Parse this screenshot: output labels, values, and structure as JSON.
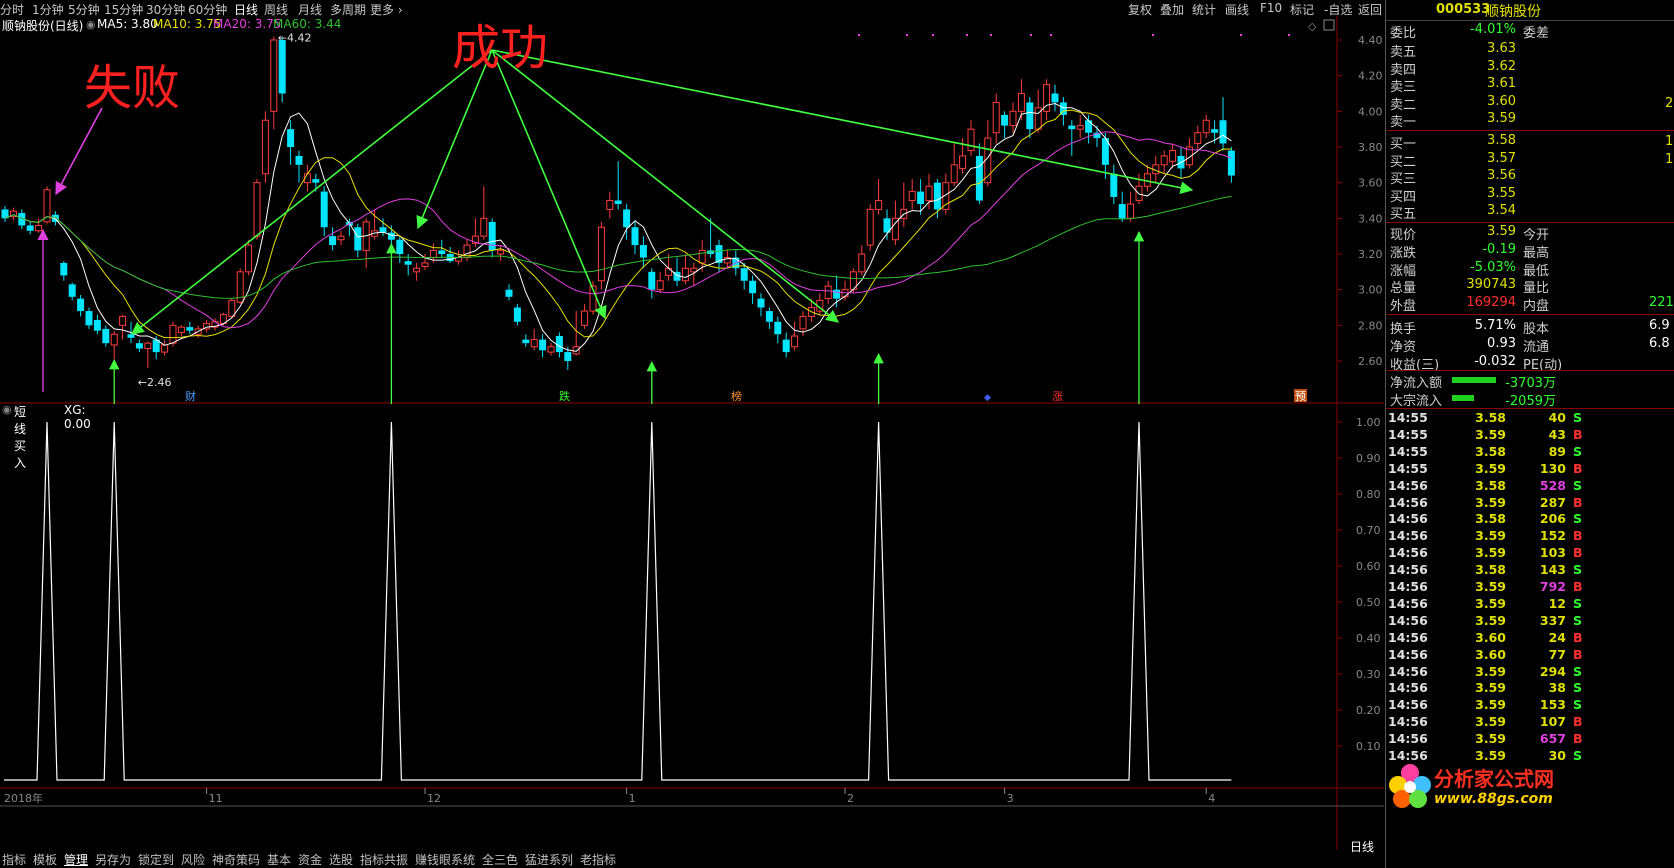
{
  "toolbar": {
    "periods": [
      "分时",
      "1分钟",
      "5分钟",
      "15分钟",
      "30分钟",
      "60分钟",
      "日线",
      "周线",
      "月线",
      "多周期",
      "更多 ›"
    ],
    "active_period": "日线",
    "right_items": [
      "复权",
      "叠加",
      "统计",
      "画线",
      "F10",
      "标记",
      "-自选",
      "返回"
    ]
  },
  "main_info": {
    "name": "顺钠股份(日线)",
    "ma5": "MA5: 3.80",
    "ma10": "MA10: 3.75",
    "ma20": "MA20: 3.75",
    "ma60": "MA60: 3.44"
  },
  "colors": {
    "up": "#ff3c3c",
    "down": "#00e5ff",
    "ma5": "#ffffff",
    "ma10": "#e8e000",
    "ma20": "#e040e0",
    "ma60": "#30c030",
    "annot_green": "#40ff40",
    "annot_red": "#ff2020",
    "annot_magenta": "#e040e0"
  },
  "annotations": {
    "fail": "失败",
    "success": "成功",
    "high_label": "4.42",
    "low_label": "2.46"
  },
  "event_tags": [
    {
      "text": "财",
      "color": "#4aa0ff"
    },
    {
      "text": "跌",
      "color": "#30ff30"
    },
    {
      "text": "榜",
      "color": "#ff9030"
    },
    {
      "text": "涨",
      "color": "#ff3030"
    },
    {
      "text": "预",
      "color": "#ffffff",
      "bg": "#c05010"
    }
  ],
  "indicator_info": {
    "name": "短线买入",
    "xg": "XG: 0.00"
  },
  "chart_data": [
    {
      "type": "candlestick",
      "title": "顺钠股份(日线)",
      "ylim": [
        2.46,
        4.42
      ],
      "y_ticks": [
        "4.40",
        "4.20",
        "4.00",
        "3.80",
        "3.60",
        "3.40",
        "3.20",
        "3.00",
        "2.80",
        "2.60"
      ],
      "x_labels": [
        "2018年",
        "11",
        "12",
        "1",
        "2",
        "3",
        "4"
      ],
      "candles": [
        [
          3.45,
          3.4,
          3.47,
          3.38
        ],
        [
          3.41,
          3.44,
          3.46,
          3.39
        ],
        [
          3.43,
          3.36,
          3.45,
          3.34
        ],
        [
          3.36,
          3.33,
          3.38,
          3.31
        ],
        [
          3.33,
          3.36,
          3.4,
          3.32
        ],
        [
          3.38,
          3.56,
          3.58,
          3.37
        ],
        [
          3.42,
          3.38,
          3.44,
          3.36
        ],
        [
          3.15,
          3.08,
          3.16,
          3.05
        ],
        [
          3.03,
          2.96,
          3.04,
          2.94
        ],
        [
          2.95,
          2.88,
          2.97,
          2.85
        ],
        [
          2.88,
          2.8,
          2.9,
          2.78
        ],
        [
          2.83,
          2.77,
          2.86,
          2.75
        ],
        [
          2.78,
          2.7,
          2.8,
          2.68
        ],
        [
          2.69,
          2.75,
          2.77,
          2.61
        ],
        [
          2.8,
          2.85,
          2.86,
          2.72
        ],
        [
          2.75,
          2.73,
          2.82,
          2.7
        ],
        [
          2.7,
          2.67,
          2.72,
          2.65
        ],
        [
          2.67,
          2.7,
          2.71,
          2.56
        ],
        [
          2.72,
          2.65,
          2.74,
          2.61
        ],
        [
          2.65,
          2.69,
          2.72,
          2.63
        ],
        [
          2.7,
          2.8,
          2.82,
          2.68
        ],
        [
          2.76,
          2.79,
          2.8,
          2.74
        ],
        [
          2.79,
          2.77,
          2.82,
          2.75
        ],
        [
          2.75,
          2.78,
          2.8,
          2.73
        ],
        [
          2.78,
          2.81,
          2.83,
          2.76
        ],
        [
          2.79,
          2.82,
          2.84,
          2.77
        ],
        [
          2.81,
          2.86,
          2.87,
          2.8
        ],
        [
          2.85,
          2.94,
          2.95,
          2.84
        ],
        [
          2.93,
          3.1,
          3.12,
          2.92
        ],
        [
          3.1,
          3.25,
          3.28,
          3.08
        ],
        [
          3.3,
          3.6,
          3.62,
          3.28
        ],
        [
          3.65,
          3.95,
          4.0,
          3.6
        ],
        [
          4.0,
          4.4,
          4.42,
          3.9
        ],
        [
          4.4,
          4.1,
          4.42,
          4.05
        ],
        [
          3.9,
          3.8,
          3.95,
          3.7
        ],
        [
          3.75,
          3.7,
          3.78,
          3.6
        ],
        [
          3.6,
          3.65,
          3.7,
          3.55
        ],
        [
          3.62,
          3.6,
          3.65,
          3.55
        ],
        [
          3.55,
          3.35,
          3.58,
          3.3
        ],
        [
          3.3,
          3.25,
          3.35,
          3.22
        ],
        [
          3.28,
          3.3,
          3.33,
          3.25
        ],
        [
          3.38,
          3.36,
          3.4,
          3.3
        ],
        [
          3.35,
          3.22,
          3.37,
          3.18
        ],
        [
          3.22,
          3.38,
          3.4,
          3.12
        ],
        [
          3.3,
          3.33,
          3.45,
          3.28
        ],
        [
          3.35,
          3.32,
          3.4,
          3.3
        ],
        [
          3.32,
          3.28,
          3.36,
          3.24
        ],
        [
          3.28,
          3.2,
          3.3,
          3.15
        ],
        [
          3.16,
          3.14,
          3.2,
          3.08
        ],
        [
          3.1,
          3.12,
          3.15,
          3.05
        ],
        [
          3.13,
          3.15,
          3.2,
          3.11
        ],
        [
          3.18,
          3.22,
          3.26,
          3.15
        ],
        [
          3.22,
          3.2,
          3.28,
          3.18
        ],
        [
          3.2,
          3.16,
          3.24,
          3.15
        ],
        [
          3.16,
          3.18,
          3.22,
          3.14
        ],
        [
          3.18,
          3.25,
          3.28,
          3.16
        ],
        [
          3.26,
          3.3,
          3.4,
          3.24
        ],
        [
          3.3,
          3.4,
          3.58,
          3.28
        ],
        [
          3.38,
          3.22,
          3.4,
          3.18
        ],
        [
          3.2,
          3.22,
          3.25,
          3.16
        ],
        [
          3.0,
          2.96,
          3.03,
          2.94
        ],
        [
          2.9,
          2.82,
          2.92,
          2.8
        ],
        [
          2.72,
          2.7,
          2.75,
          2.68
        ],
        [
          2.68,
          2.72,
          2.78,
          2.66
        ],
        [
          2.72,
          2.66,
          2.75,
          2.62
        ],
        [
          2.65,
          2.68,
          2.7,
          2.63
        ],
        [
          2.74,
          2.65,
          2.76,
          2.62
        ],
        [
          2.65,
          2.6,
          2.68,
          2.55
        ],
        [
          2.64,
          2.68,
          2.88,
          2.63
        ],
        [
          2.8,
          2.88,
          2.92,
          2.78
        ],
        [
          2.88,
          3.02,
          3.05,
          2.86
        ],
        [
          3.05,
          3.35,
          3.38,
          3.0
        ],
        [
          3.45,
          3.5,
          3.55,
          3.4
        ],
        [
          3.5,
          3.48,
          3.72,
          3.45
        ],
        [
          3.45,
          3.35,
          3.48,
          3.28
        ],
        [
          3.35,
          3.25,
          3.38,
          3.2
        ],
        [
          3.25,
          3.18,
          3.3,
          3.12
        ],
        [
          3.1,
          3.0,
          3.12,
          2.95
        ],
        [
          3.0,
          3.05,
          3.1,
          2.98
        ],
        [
          3.08,
          3.12,
          3.2,
          3.05
        ],
        [
          3.1,
          3.05,
          3.18,
          3.02
        ],
        [
          3.05,
          3.12,
          3.2,
          3.03
        ],
        [
          3.1,
          3.12,
          3.15,
          3.02
        ],
        [
          3.15,
          3.22,
          3.28,
          3.1
        ],
        [
          3.22,
          3.2,
          3.4,
          3.18
        ],
        [
          3.25,
          3.15,
          3.28,
          3.1
        ],
        [
          3.15,
          3.18,
          3.22,
          3.12
        ],
        [
          3.18,
          3.12,
          3.22,
          3.08
        ],
        [
          3.12,
          3.05,
          3.15,
          3.0
        ],
        [
          3.05,
          2.98,
          3.08,
          2.92
        ],
        [
          2.95,
          2.9,
          2.98,
          2.85
        ],
        [
          2.88,
          2.82,
          2.9,
          2.78
        ],
        [
          2.82,
          2.75,
          2.85,
          2.7
        ],
        [
          2.72,
          2.65,
          2.76,
          2.62
        ],
        [
          2.68,
          2.74,
          2.82,
          2.66
        ],
        [
          2.78,
          2.85,
          2.88,
          2.74
        ],
        [
          2.85,
          2.9,
          2.95,
          2.82
        ],
        [
          2.88,
          2.94,
          2.98,
          2.86
        ],
        [
          2.95,
          3.02,
          3.05,
          2.92
        ],
        [
          3.0,
          2.95,
          3.08,
          2.9
        ],
        [
          2.96,
          3.0,
          3.05,
          2.94
        ],
        [
          3.0,
          3.1,
          3.12,
          2.98
        ],
        [
          3.1,
          3.2,
          3.25,
          3.08
        ],
        [
          3.25,
          3.45,
          3.48,
          3.22
        ],
        [
          3.45,
          3.5,
          3.62,
          3.42
        ],
        [
          3.4,
          3.32,
          3.45,
          3.28
        ],
        [
          3.28,
          3.4,
          3.5,
          3.25
        ],
        [
          3.4,
          3.45,
          3.6,
          3.35
        ],
        [
          3.5,
          3.55,
          3.62,
          3.45
        ],
        [
          3.55,
          3.48,
          3.62,
          3.42
        ],
        [
          3.5,
          3.58,
          3.65,
          3.45
        ],
        [
          3.6,
          3.45,
          3.62,
          3.4
        ],
        [
          3.45,
          3.6,
          3.65,
          3.42
        ],
        [
          3.6,
          3.7,
          3.82,
          3.58
        ],
        [
          3.68,
          3.75,
          3.85,
          3.65
        ],
        [
          3.78,
          3.9,
          3.95,
          3.75
        ],
        [
          3.75,
          3.5,
          3.82,
          3.48
        ],
        [
          3.6,
          3.85,
          3.95,
          3.58
        ],
        [
          3.88,
          4.05,
          4.1,
          3.82
        ],
        [
          3.98,
          3.92,
          4.0,
          3.85
        ],
        [
          3.92,
          4.0,
          4.05,
          3.88
        ],
        [
          4.0,
          4.1,
          4.18,
          3.95
        ],
        [
          4.05,
          3.9,
          4.08,
          3.85
        ],
        [
          3.9,
          4.02,
          4.12,
          3.88
        ],
        [
          4.0,
          4.15,
          4.18,
          3.95
        ],
        [
          4.1,
          4.05,
          4.15,
          4.0
        ],
        [
          4.05,
          3.98,
          4.08,
          3.92
        ],
        [
          3.92,
          3.9,
          3.95,
          3.75
        ],
        [
          3.9,
          3.92,
          3.98,
          3.85
        ],
        [
          3.95,
          3.88,
          3.98,
          3.82
        ],
        [
          3.88,
          3.85,
          3.92,
          3.8
        ],
        [
          3.85,
          3.7,
          3.88,
          3.62
        ],
        [
          3.65,
          3.52,
          3.7,
          3.48
        ],
        [
          3.48,
          3.4,
          3.55,
          3.38
        ],
        [
          3.4,
          3.48,
          3.55,
          3.38
        ],
        [
          3.5,
          3.58,
          3.65,
          3.48
        ],
        [
          3.58,
          3.65,
          3.7,
          3.55
        ],
        [
          3.65,
          3.7,
          3.75,
          3.6
        ],
        [
          3.7,
          3.75,
          3.78,
          3.65
        ],
        [
          3.72,
          3.78,
          3.82,
          3.68
        ],
        [
          3.75,
          3.68,
          3.8,
          3.62
        ],
        [
          3.7,
          3.8,
          3.85,
          3.68
        ],
        [
          3.82,
          3.88,
          3.92,
          3.78
        ],
        [
          3.88,
          3.95,
          3.98,
          3.85
        ],
        [
          3.9,
          3.88,
          3.95,
          3.82
        ],
        [
          3.95,
          3.82,
          4.08,
          3.78
        ],
        [
          3.78,
          3.64,
          3.8,
          3.6
        ]
      ]
    },
    {
      "type": "line",
      "title": "短线买入",
      "ylim": [
        0.0,
        1.0
      ],
      "y_ticks": [
        "1.00",
        "0.90",
        "0.80",
        "0.70",
        "0.60",
        "0.50",
        "0.40",
        "0.30",
        "0.20",
        "0.10"
      ],
      "signal_bars": [
        5,
        13,
        46,
        77,
        104,
        135
      ],
      "series": [
        {
          "name": "XG",
          "values": [
            0
          ]
        }
      ]
    }
  ],
  "quote": {
    "code": "000533",
    "name": "顺钠股份",
    "weibi_label": "委比",
    "weibi_value": "-4.01%",
    "weicha_label": "委差",
    "asks": [
      {
        "label": "卖五",
        "price": "3.63"
      },
      {
        "label": "卖四",
        "price": "3.62"
      },
      {
        "label": "卖三",
        "price": "3.61"
      },
      {
        "label": "卖二",
        "price": "3.60"
      },
      {
        "label": "卖一",
        "price": "3.59"
      }
    ],
    "bids": [
      {
        "label": "买一",
        "price": "3.58"
      },
      {
        "label": "买二",
        "price": "3.57"
      },
      {
        "label": "买三",
        "price": "3.56"
      },
      {
        "label": "买四",
        "price": "3.55"
      },
      {
        "label": "买五",
        "price": "3.54"
      }
    ],
    "ask_vol_2": "2",
    "bid_vol_1": "1",
    "bid_vol_2": "1",
    "stats": [
      {
        "label": "现价",
        "value": "3.59",
        "label2": "今开",
        "value2": ""
      },
      {
        "label": "涨跌",
        "value": "-0.19",
        "label2": "最高",
        "value2": ""
      },
      {
        "label": "涨幅",
        "value": "-5.03%",
        "label2": "最低",
        "value2": ""
      },
      {
        "label": "总量",
        "value": "390743",
        "label2": "量比",
        "value2": ""
      },
      {
        "label": "外盘",
        "value": "169294",
        "label2": "内盘",
        "value2": "221"
      },
      {
        "label": "换手",
        "value": "5.71%",
        "label2": "股本",
        "value2": "6.9"
      },
      {
        "label": "净资",
        "value": "0.93",
        "label2": "流通",
        "value2": "6.8"
      },
      {
        "label": "收益(三)",
        "value": "-0.032",
        "label2": "PE(动)",
        "value2": ""
      }
    ],
    "flows": [
      {
        "label": "净流入额",
        "value": "-3703万",
        "bar": 0.5
      },
      {
        "label": "大宗流入",
        "value": "-2059万",
        "bar": 0.25
      }
    ]
  },
  "ticks": [
    [
      "14:55",
      "3.58",
      "40",
      "S"
    ],
    [
      "14:55",
      "3.59",
      "43",
      "B"
    ],
    [
      "14:55",
      "3.58",
      "89",
      "S"
    ],
    [
      "14:55",
      "3.59",
      "130",
      "B"
    ],
    [
      "14:56",
      "3.58",
      "528",
      "S"
    ],
    [
      "14:56",
      "3.59",
      "287",
      "B"
    ],
    [
      "14:56",
      "3.58",
      "206",
      "S"
    ],
    [
      "14:56",
      "3.59",
      "152",
      "B"
    ],
    [
      "14:56",
      "3.59",
      "103",
      "B"
    ],
    [
      "14:56",
      "3.58",
      "143",
      "S"
    ],
    [
      "14:56",
      "3.59",
      "792",
      "B"
    ],
    [
      "14:56",
      "3.59",
      "12",
      "S"
    ],
    [
      "14:56",
      "3.59",
      "337",
      "S"
    ],
    [
      "14:56",
      "3.60",
      "24",
      "B"
    ],
    [
      "14:56",
      "3.60",
      "77",
      "B"
    ],
    [
      "14:56",
      "3.59",
      "294",
      "S"
    ],
    [
      "14:56",
      "3.59",
      "38",
      "S"
    ],
    [
      "14:56",
      "3.59",
      "153",
      "S"
    ],
    [
      "14:56",
      "3.59",
      "107",
      "B"
    ],
    [
      "14:56",
      "3.59",
      "657",
      "B"
    ],
    [
      "14:56",
      "3.59",
      "30",
      "S"
    ]
  ],
  "bottom_tabs": [
    "指标",
    "模板",
    "管理",
    "另存为",
    "锁定到",
    "风险",
    "神奇策码",
    "基本",
    "资金",
    "选股",
    "指标共振",
    "赚钱眼系统",
    "全三色",
    "猛进系列",
    "老指标"
  ],
  "bottom_right": "日线",
  "watermark": {
    "title": "分析家公式网",
    "url": "www.88gs.com"
  }
}
